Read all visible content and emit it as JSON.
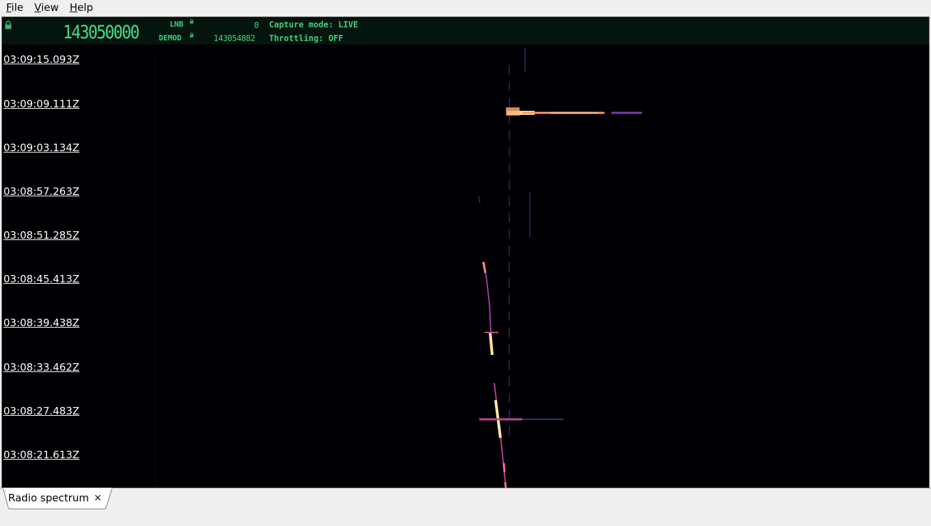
{
  "menu": [
    "File",
    "View",
    "Help"
  ],
  "status": {
    "main_frequency": "143050000",
    "lnb_label": "LNB",
    "lnb_value": "0",
    "demod_label": "DEMOD",
    "demod_value": "143054882",
    "capture_mode": "Capture mode: LIVE",
    "throttling": "Throttling: OFF"
  },
  "timestamps": [
    "03:09:15.093Z",
    "03:09:09.111Z",
    "03:09:03.134Z",
    "03:08:57.263Z",
    "03:08:51.285Z",
    "03:08:45.413Z",
    "03:08:39.438Z",
    "03:08:33.462Z",
    "03:08:27.483Z",
    "03:08:21.613Z"
  ],
  "tab": {
    "label": "Radio spectrum",
    "close": "×"
  },
  "colors": {
    "accent": "#3fd080",
    "waterfall_bg": "#000000"
  }
}
